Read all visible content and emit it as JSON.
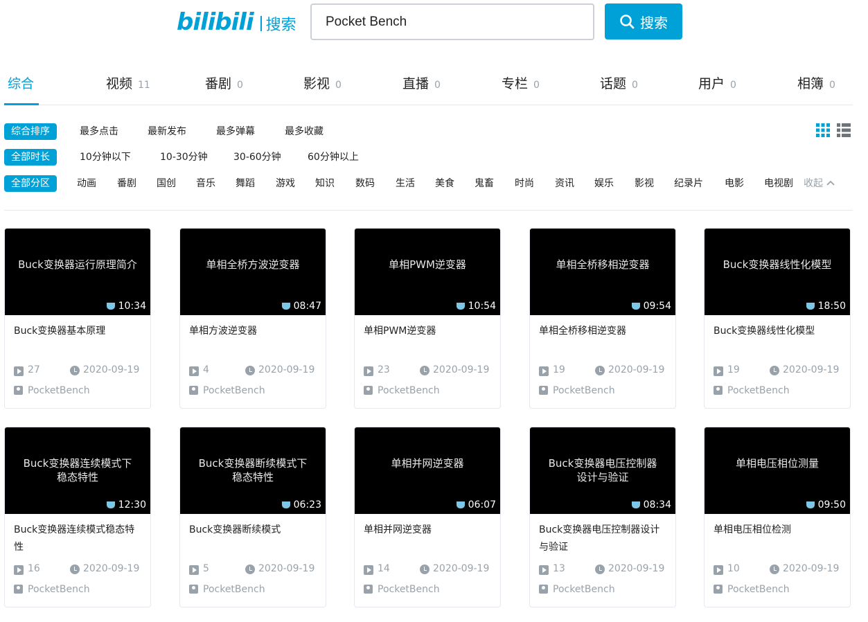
{
  "header": {
    "logo": "bilibili",
    "logo_suffix": "搜索",
    "search_value": "Pocket Bench",
    "search_button": "搜索"
  },
  "tabs": [
    {
      "label": "综合",
      "count": ""
    },
    {
      "label": "视频",
      "count": "11"
    },
    {
      "label": "番剧",
      "count": "0"
    },
    {
      "label": "影视",
      "count": "0"
    },
    {
      "label": "直播",
      "count": "0"
    },
    {
      "label": "专栏",
      "count": "0"
    },
    {
      "label": "话题",
      "count": "0"
    },
    {
      "label": "用户",
      "count": "0"
    },
    {
      "label": "相簿",
      "count": "0"
    }
  ],
  "filters": {
    "sort": {
      "active": "综合排序",
      "options": [
        "最多点击",
        "最新发布",
        "最多弹幕",
        "最多收藏"
      ]
    },
    "duration": {
      "active": "全部时长",
      "options": [
        "10分钟以下",
        "10-30分钟",
        "30-60分钟",
        "60分钟以上"
      ]
    },
    "zone": {
      "active": "全部分区",
      "options": [
        "动画",
        "番剧",
        "国创",
        "音乐",
        "舞蹈",
        "游戏",
        "知识",
        "数码",
        "生活",
        "美食",
        "鬼畜",
        "时尚",
        "资讯",
        "娱乐",
        "影视",
        "纪录片",
        "电影",
        "电视剧"
      ],
      "collapse": "收起"
    }
  },
  "videos": [
    {
      "thumb_text": "Buck变换器运行原理简介",
      "duration": "10:34",
      "title": "Buck变换器基本原理",
      "plays": "27",
      "date": "2020-09-19",
      "author": "PocketBench"
    },
    {
      "thumb_text": "单相全桥方波逆变器",
      "duration": "08:47",
      "title": "单相方波逆变器",
      "plays": "4",
      "date": "2020-09-19",
      "author": "PocketBench"
    },
    {
      "thumb_text": "单相PWM逆变器",
      "duration": "10:54",
      "title": "单相PWM逆变器",
      "plays": "23",
      "date": "2020-09-19",
      "author": "PocketBench"
    },
    {
      "thumb_text": "单相全桥移相逆变器",
      "duration": "09:54",
      "title": "单相全桥移相逆变器",
      "plays": "19",
      "date": "2020-09-19",
      "author": "PocketBench"
    },
    {
      "thumb_text": "Buck变换器线性化模型",
      "duration": "18:50",
      "title": "Buck变换器线性化模型",
      "plays": "19",
      "date": "2020-09-19",
      "author": "PocketBench"
    },
    {
      "thumb_text": "Buck变换器连续模式下\n稳态特性",
      "duration": "12:30",
      "title": "Buck变换器连续模式稳态特性",
      "plays": "16",
      "date": "2020-09-19",
      "author": "PocketBench"
    },
    {
      "thumb_text": "Buck变换器断续模式下\n稳态特性",
      "duration": "06:23",
      "title": "Buck变换器断续模式",
      "plays": "5",
      "date": "2020-09-19",
      "author": "PocketBench"
    },
    {
      "thumb_text": "单相并网逆变器",
      "duration": "06:07",
      "title": "单相并网逆变器",
      "plays": "14",
      "date": "2020-09-19",
      "author": "PocketBench"
    },
    {
      "thumb_text": "Buck变换器电压控制器\n设计与验证",
      "duration": "08:34",
      "title": "Buck变换器电压控制器设计与验证",
      "plays": "13",
      "date": "2020-09-19",
      "author": "PocketBench"
    },
    {
      "thumb_text": "单相电压相位测量",
      "duration": "09:50",
      "title": "单相电压相位检测",
      "plays": "10",
      "date": "2020-09-19",
      "author": "PocketBench"
    }
  ]
}
